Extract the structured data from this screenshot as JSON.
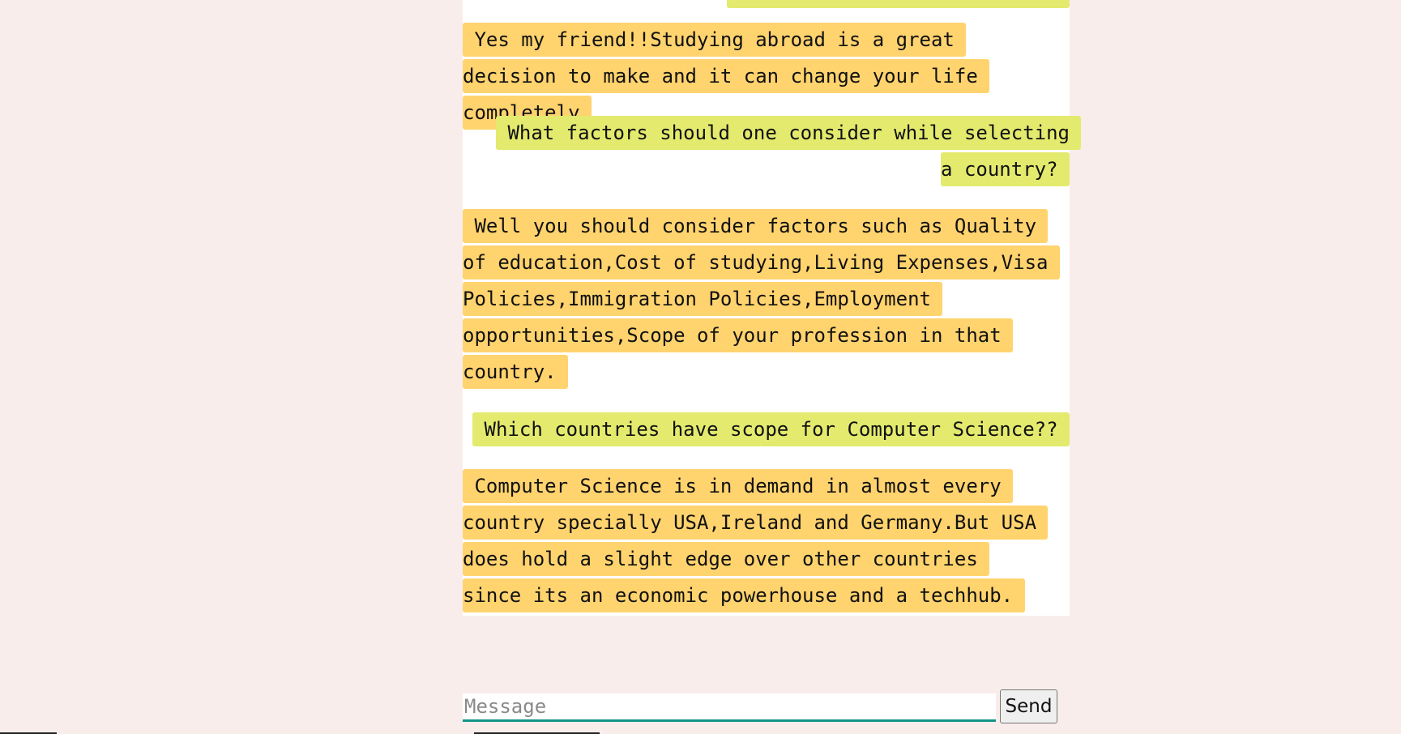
{
  "conversation": {
    "messages": [
      {
        "role": "bot",
        "text": " Yes my friend!!Studying abroad is a great decision to make and it can change your life completely "
      },
      {
        "role": "user",
        "text": " What factors should one consider while selecting a country? "
      },
      {
        "role": "bot",
        "text": " Well you should consider factors such as Quality of education,Cost of studying,Living Expenses,Visa Policies,Immigration Policies,Employment opportunities,Scope of your profession in that country. "
      },
      {
        "role": "user",
        "text": " Which countries have scope for Computer Science?? "
      },
      {
        "role": "bot",
        "text": " Computer Science is in demand in almost every country specially USA,Ireland and Germany.But USA does hold a slight edge over other countries since its an economic powerhouse and a techhub. "
      }
    ]
  },
  "composer": {
    "placeholder": "Message",
    "value": "",
    "send_label": "Send"
  },
  "colors": {
    "page_background": "#f9edec",
    "bot_bubble": "#ffd36e",
    "user_bubble": "#e3ea6e",
    "input_underline": "#139487"
  }
}
